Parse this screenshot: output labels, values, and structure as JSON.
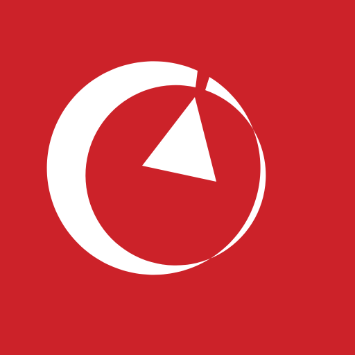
{
  "app_icon": {
    "icon": "stopwatch-pointer-icon",
    "colors": {
      "background": "#cc2229",
      "foreground": "#ffffff"
    }
  }
}
